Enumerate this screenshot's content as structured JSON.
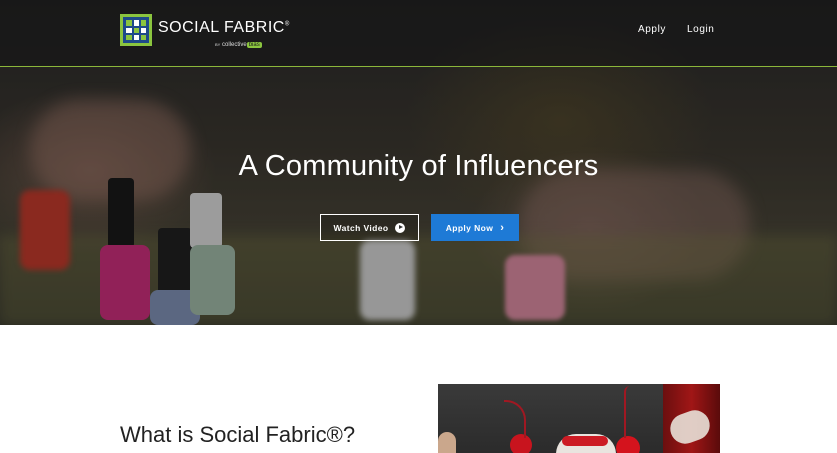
{
  "brand": {
    "name": "SOCIAL FABRIC",
    "trademark": "®",
    "byline_prefix": "BY",
    "byline_name": "collective",
    "byline_highlight": "bias",
    "colors": {
      "accent_green": "#8bb73a",
      "primary_blue": "#1e7ad6"
    }
  },
  "nav": {
    "links": [
      {
        "label": "Apply"
      },
      {
        "label": "Login"
      }
    ]
  },
  "hero": {
    "headline": "A Community of Influencers",
    "buttons": {
      "watch": {
        "label": "Watch Video",
        "icon": "play-circle-icon"
      },
      "apply": {
        "label": "Apply Now",
        "icon": "chevron-right-icon"
      }
    }
  },
  "section": {
    "title": "What is Social Fabric®?"
  }
}
